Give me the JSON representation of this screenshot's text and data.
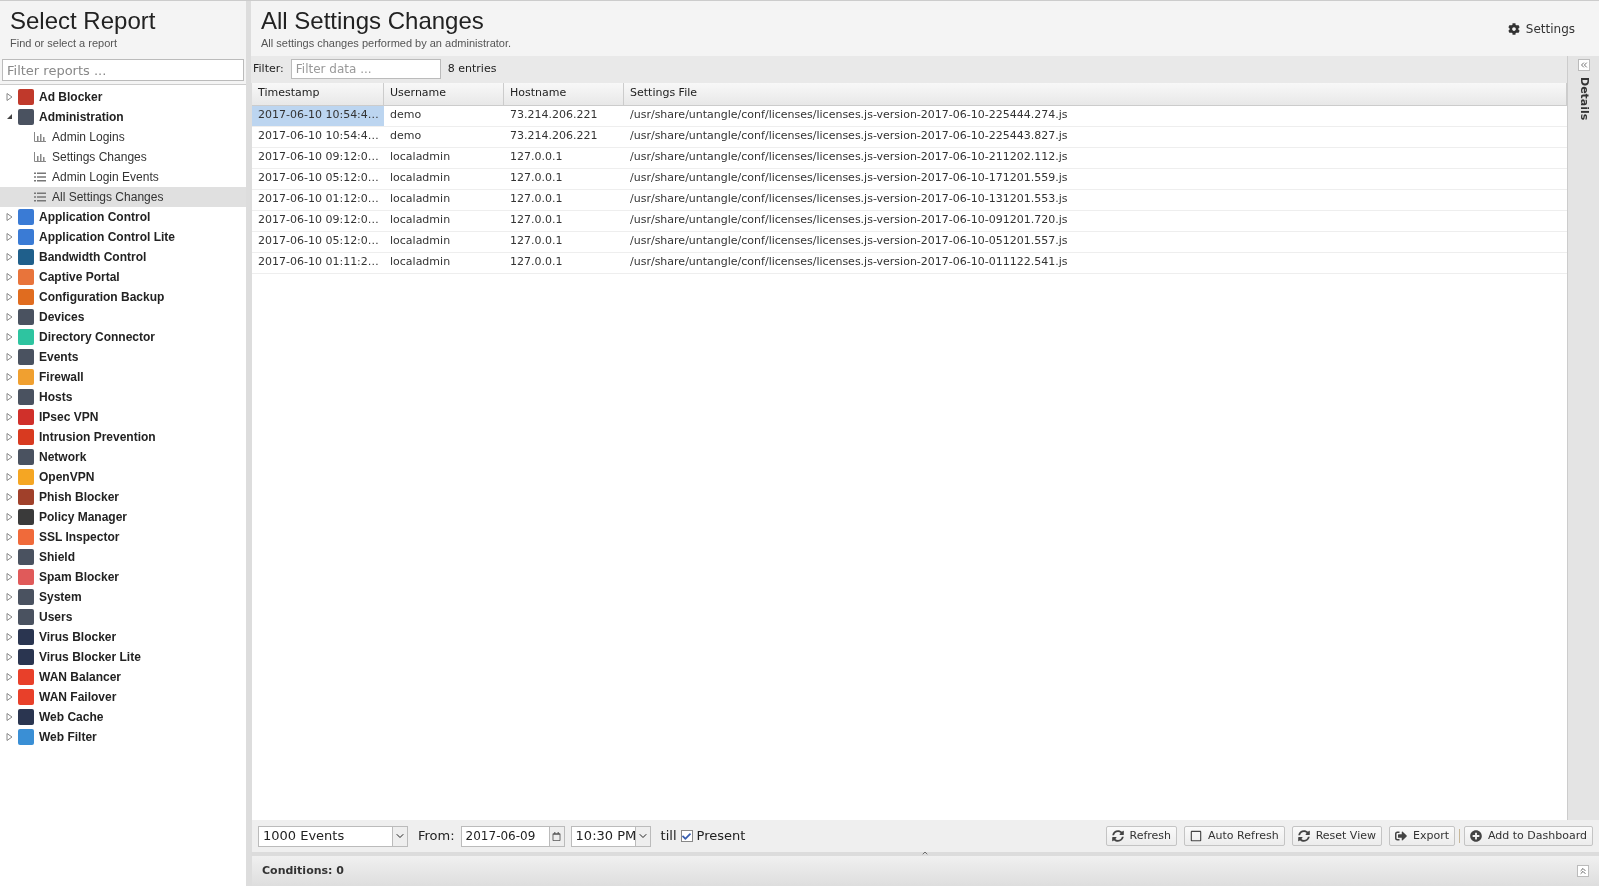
{
  "sidebar": {
    "title": "Select Report",
    "subtitle": "Find or select a report",
    "filter": {
      "placeholder": "Filter reports ..."
    },
    "items": [
      {
        "label": "Ad Blocker",
        "color": "#c0392b",
        "expanded": false,
        "selected": false
      },
      {
        "label": "Administration",
        "color": "#4a5260",
        "expanded": true,
        "selected": false,
        "children": [
          {
            "label": "Admin Logins",
            "kind": "chart",
            "selected": false
          },
          {
            "label": "Settings Changes",
            "kind": "chart",
            "selected": false
          },
          {
            "label": "Admin Login Events",
            "kind": "list",
            "selected": false
          },
          {
            "label": "All Settings Changes",
            "kind": "list",
            "selected": true
          }
        ]
      },
      {
        "label": "Application Control",
        "color": "#3a7bd5",
        "expanded": false,
        "selected": false
      },
      {
        "label": "Application Control Lite",
        "color": "#3a7bd5",
        "expanded": false,
        "selected": false
      },
      {
        "label": "Bandwidth Control",
        "color": "#1f5f8b",
        "expanded": false,
        "selected": false
      },
      {
        "label": "Captive Portal",
        "color": "#e8743b",
        "expanded": false,
        "selected": false
      },
      {
        "label": "Configuration Backup",
        "color": "#e06c1f",
        "expanded": false,
        "selected": false
      },
      {
        "label": "Devices",
        "color": "#4a5260",
        "expanded": false,
        "selected": false
      },
      {
        "label": "Directory Connector",
        "color": "#2ec4a0",
        "expanded": false,
        "selected": false
      },
      {
        "label": "Events",
        "color": "#4a5260",
        "expanded": false,
        "selected": false
      },
      {
        "label": "Firewall",
        "color": "#f0a030",
        "expanded": false,
        "selected": false
      },
      {
        "label": "Hosts",
        "color": "#4a5260",
        "expanded": false,
        "selected": false
      },
      {
        "label": "IPsec VPN",
        "color": "#d0302a",
        "expanded": false,
        "selected": false
      },
      {
        "label": "Intrusion Prevention",
        "color": "#d83a20",
        "expanded": false,
        "selected": false
      },
      {
        "label": "Network",
        "color": "#4a5260",
        "expanded": false,
        "selected": false
      },
      {
        "label": "OpenVPN",
        "color": "#f5a623",
        "expanded": false,
        "selected": false
      },
      {
        "label": "Phish Blocker",
        "color": "#a0402a",
        "expanded": false,
        "selected": false
      },
      {
        "label": "Policy Manager",
        "color": "#3a3a3a",
        "expanded": false,
        "selected": false
      },
      {
        "label": "SSL Inspector",
        "color": "#f06a3a",
        "expanded": false,
        "selected": false
      },
      {
        "label": "Shield",
        "color": "#4a5260",
        "expanded": false,
        "selected": false
      },
      {
        "label": "Spam Blocker",
        "color": "#e05a5a",
        "expanded": false,
        "selected": false
      },
      {
        "label": "System",
        "color": "#4a5260",
        "expanded": false,
        "selected": false
      },
      {
        "label": "Users",
        "color": "#4a5260",
        "expanded": false,
        "selected": false
      },
      {
        "label": "Virus Blocker",
        "color": "#2a3550",
        "expanded": false,
        "selected": false
      },
      {
        "label": "Virus Blocker Lite",
        "color": "#2a3550",
        "expanded": false,
        "selected": false
      },
      {
        "label": "WAN Balancer",
        "color": "#e8402a",
        "expanded": false,
        "selected": false
      },
      {
        "label": "WAN Failover",
        "color": "#e8402a",
        "expanded": false,
        "selected": false
      },
      {
        "label": "Web Cache",
        "color": "#2a3550",
        "expanded": false,
        "selected": false
      },
      {
        "label": "Web Filter",
        "color": "#3a8fd5",
        "expanded": false,
        "selected": false
      }
    ]
  },
  "report": {
    "title": "All Settings Changes",
    "subtitle": "All settings changes performed by an administrator.",
    "settings_button": "Settings"
  },
  "filter": {
    "label": "Filter:",
    "placeholder": "Filter data ...",
    "count": "8 entries"
  },
  "table": {
    "columns": [
      "Timestamp",
      "Username",
      "Hostname",
      "Settings File"
    ],
    "rows": [
      {
        "cells": [
          "2017-06-10 10:54:4…",
          "demo",
          "73.214.206.221",
          "/usr/share/untangle/conf/licenses/licenses.js-version-2017-06-10-225444.274.js"
        ],
        "selected": true
      },
      {
        "cells": [
          "2017-06-10 10:54:4…",
          "demo",
          "73.214.206.221",
          "/usr/share/untangle/conf/licenses/licenses.js-version-2017-06-10-225443.827.js"
        ],
        "selected": false
      },
      {
        "cells": [
          "2017-06-10 09:12:0…",
          "localadmin",
          "127.0.0.1",
          "/usr/share/untangle/conf/licenses/licenses.js-version-2017-06-10-211202.112.js"
        ],
        "selected": false
      },
      {
        "cells": [
          "2017-06-10 05:12:0…",
          "localadmin",
          "127.0.0.1",
          "/usr/share/untangle/conf/licenses/licenses.js-version-2017-06-10-171201.559.js"
        ],
        "selected": false
      },
      {
        "cells": [
          "2017-06-10 01:12:0…",
          "localadmin",
          "127.0.0.1",
          "/usr/share/untangle/conf/licenses/licenses.js-version-2017-06-10-131201.553.js"
        ],
        "selected": false
      },
      {
        "cells": [
          "2017-06-10 09:12:0…",
          "localadmin",
          "127.0.0.1",
          "/usr/share/untangle/conf/licenses/licenses.js-version-2017-06-10-091201.720.js"
        ],
        "selected": false
      },
      {
        "cells": [
          "2017-06-10 05:12:0…",
          "localadmin",
          "127.0.0.1",
          "/usr/share/untangle/conf/licenses/licenses.js-version-2017-06-10-051201.557.js"
        ],
        "selected": false
      },
      {
        "cells": [
          "2017-06-10 01:11:2…",
          "localadmin",
          "127.0.0.1",
          "/usr/share/untangle/conf/licenses/licenses.js-version-2017-06-10-011122.541.js"
        ],
        "selected": false
      }
    ]
  },
  "details_panel": {
    "label": "Details"
  },
  "toolbar": {
    "limit": "1000 Events",
    "from_label": "From:",
    "date": "2017-06-09",
    "time": "10:30 PM",
    "till_label": "till",
    "present": {
      "label": "Present",
      "checked": true
    },
    "buttons": [
      {
        "label": "Refresh",
        "kind": "refresh"
      },
      {
        "label": "Auto Refresh",
        "kind": "checkbox"
      },
      {
        "label": "Reset View",
        "kind": "refresh"
      },
      {
        "label": "Export",
        "kind": "export"
      },
      {
        "label": "Add to Dashboard",
        "kind": "add"
      }
    ]
  },
  "conditions": "Conditions: 0"
}
